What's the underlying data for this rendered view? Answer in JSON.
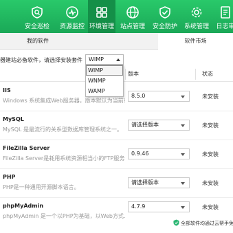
{
  "nav": {
    "items": [
      {
        "label": "安全巡检",
        "icon": "shield-search-icon"
      },
      {
        "label": "资源监控",
        "icon": "monitor-icon"
      },
      {
        "label": "环境管理",
        "icon": "grid-icon",
        "active": true
      },
      {
        "label": "站点管理",
        "icon": "globe-icon"
      },
      {
        "label": "安全防护",
        "icon": "shield-check-icon"
      },
      {
        "label": "系统管理",
        "icon": "gear-icon"
      },
      {
        "label": "日志审",
        "icon": "document-icon"
      }
    ]
  },
  "subtabs": {
    "my_software": "我的软件",
    "market": "软件市场"
  },
  "install": {
    "label": "器建站必备软件，请选择安装套件",
    "selected": "WIMP",
    "options": [
      "WIMP",
      "WNMP",
      "WAMP"
    ]
  },
  "table": {
    "col_version": "版本",
    "col_status": "状态"
  },
  "software": [
    {
      "name": "IIS",
      "desc": "Windows 系统集成Web服务器，版本默认为当前系统...",
      "version": "8.5.0",
      "status": "未安装"
    },
    {
      "name": "MySQL",
      "desc": "MySQL 是最流行的关系型数据库管理系统之一。",
      "version": "请选择版本",
      "status": "未安装"
    },
    {
      "name": "FileZilla Server",
      "desc": "FileZilla Server是耗用系统资源相当小的FTP服务器软...",
      "version": "0.9.46",
      "status": "未安装"
    },
    {
      "name": "PHP",
      "desc": "PHP是一种通用开源脚本语言。",
      "version": "请选择版本",
      "status": "未安装"
    },
    {
      "name": "phpMyAdmin",
      "desc": "phpMyAdmin 是一个以PHP为基础，以Web方式...",
      "version": "4.7.9",
      "status": "未安装"
    }
  ],
  "footer": {
    "note": "全部软件均通过云帮手免"
  },
  "colors": {
    "nav_green": "#1fb25f",
    "nav_active": "#148f48"
  }
}
